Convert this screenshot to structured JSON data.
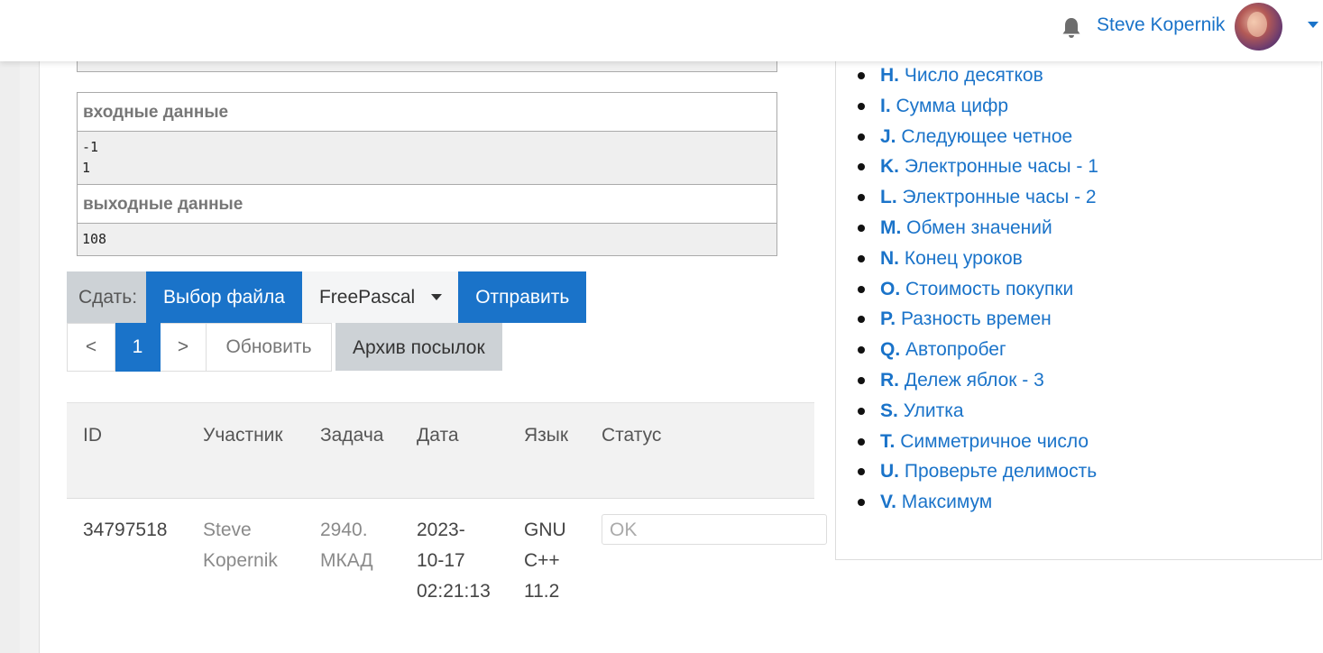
{
  "navbar": {
    "username": "Steve Kopernik"
  },
  "samples": {
    "input_title": "входные данные",
    "input_value": "-1\n1",
    "output_title": "выходные данные",
    "output_value": "108"
  },
  "submit": {
    "label": "Сдать:",
    "file_button": "Выбор файла",
    "language": "FreePascal",
    "send_button": "Отправить"
  },
  "pagination": {
    "prev": "<",
    "current": "1",
    "next": ">",
    "refresh": "Обновить",
    "archive": "Архив посылок"
  },
  "table": {
    "headers": [
      "ID",
      "Участник",
      "Задача",
      "Дата",
      "Язык",
      "Статус"
    ],
    "rows": [
      {
        "id": "34797518",
        "user_line1": "Steve",
        "user_line2": "Kopernik",
        "task_line1": "2940.",
        "task_line2": "МКАД",
        "date_line1": "2023-",
        "date_line2": "10-17",
        "date_line3": "02:21:13",
        "lang_line1": "GNU",
        "lang_line2": "C++",
        "lang_line3": "11.2",
        "status": "OK"
      }
    ]
  },
  "problems": [
    {
      "letter": "H.",
      "name": "Число десятков"
    },
    {
      "letter": "I.",
      "name": "Сумма цифр"
    },
    {
      "letter": "J.",
      "name": "Следующее четное"
    },
    {
      "letter": "K.",
      "name": "Электронные часы - 1"
    },
    {
      "letter": "L.",
      "name": "Электронные часы - 2"
    },
    {
      "letter": "M.",
      "name": "Обмен значений"
    },
    {
      "letter": "N.",
      "name": "Конец уроков"
    },
    {
      "letter": "O.",
      "name": "Стоимость покупки"
    },
    {
      "letter": "P.",
      "name": "Разность времен"
    },
    {
      "letter": "Q.",
      "name": "Автопробег"
    },
    {
      "letter": "R.",
      "name": "Дележ яблок - 3"
    },
    {
      "letter": "S.",
      "name": "Улитка"
    },
    {
      "letter": "T.",
      "name": "Симметричное число"
    },
    {
      "letter": "U.",
      "name": "Проверьте делимость"
    },
    {
      "letter": "V.",
      "name": "Максимум"
    }
  ],
  "colors": {
    "accent": "#1a73c9",
    "button_gray": "#cdd2d6"
  }
}
